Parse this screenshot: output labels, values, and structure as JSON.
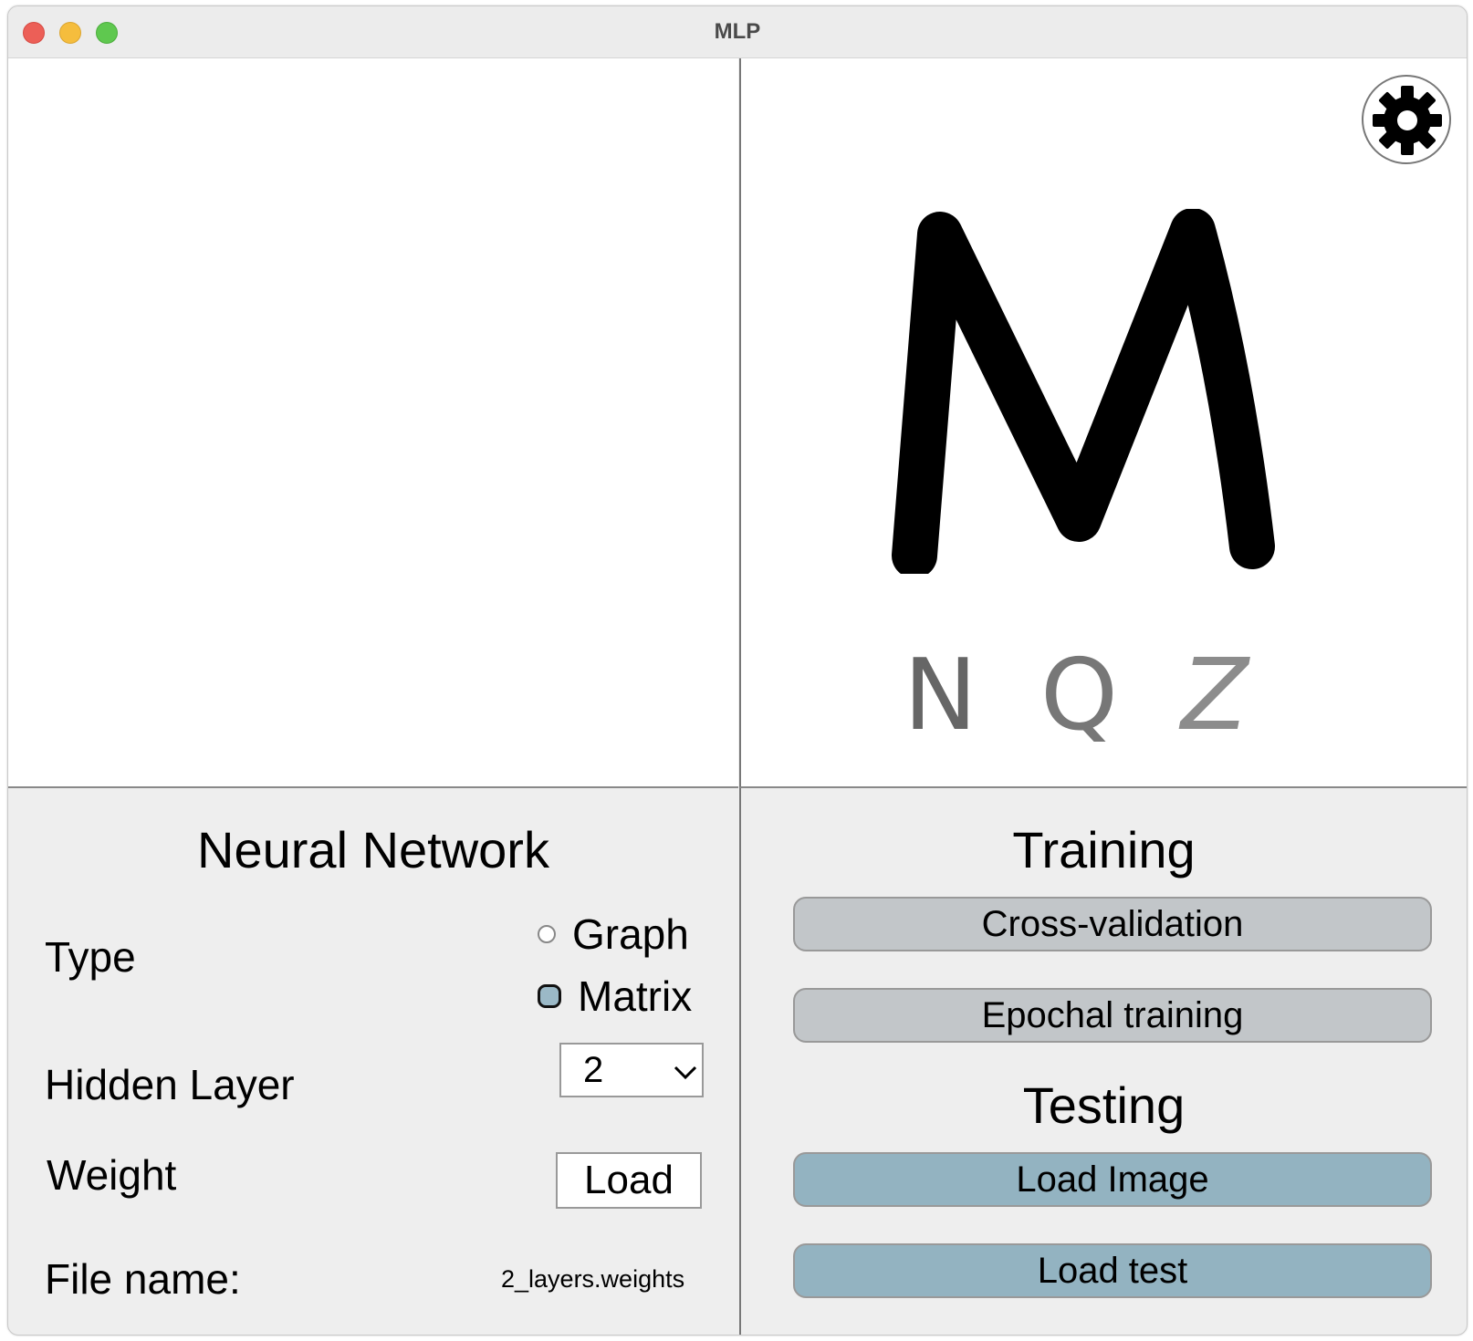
{
  "window": {
    "title": "MLP"
  },
  "recognition": {
    "top_letter": "M",
    "candidates": [
      "N",
      "Q",
      "Z"
    ]
  },
  "icons": {
    "settings": "gear-icon",
    "dropdown": "chevron-down-icon"
  },
  "neural_network": {
    "heading": "Neural Network",
    "type_label": "Type",
    "type_options": [
      {
        "label": "Graph",
        "selected": false
      },
      {
        "label": "Matrix",
        "selected": true
      }
    ],
    "hidden_layer_label": "Hidden Layer",
    "hidden_layer_value": "2",
    "weight_label": "Weight",
    "weight_button": "Load",
    "file_name_label": "File name:",
    "file_name_value": "2_layers.weights"
  },
  "training": {
    "heading": "Training",
    "buttons": [
      "Cross-validation",
      "Epochal training"
    ]
  },
  "testing": {
    "heading": "Testing",
    "buttons": [
      "Load Image",
      "Load test"
    ]
  },
  "colors": {
    "training_button": "#c2c6c9",
    "testing_button": "#93b3c1",
    "selected_radio": "#9bb9c7"
  }
}
